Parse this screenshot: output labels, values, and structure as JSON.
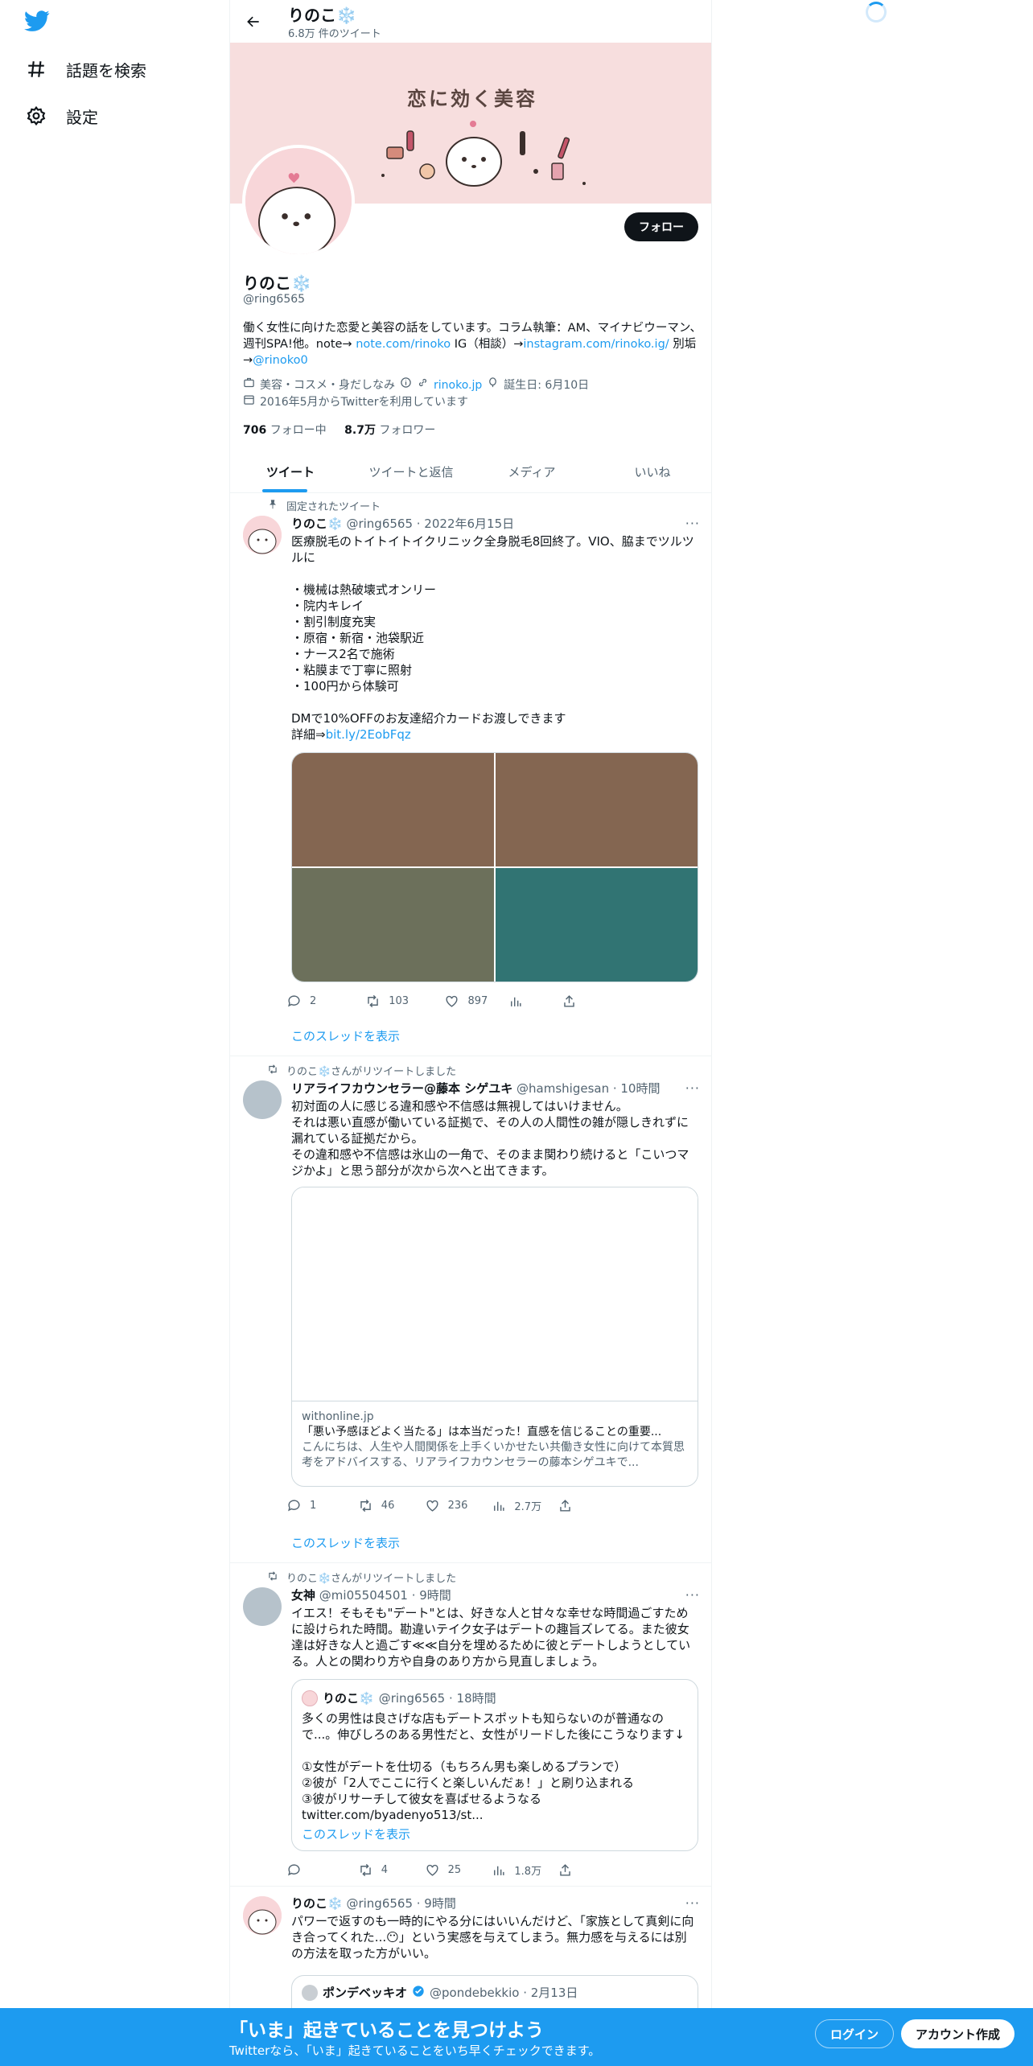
{
  "nav": {
    "logo": "twitter-bird",
    "items": [
      {
        "label": "話題を検索",
        "icon": "hashtag-icon"
      },
      {
        "label": "設定",
        "icon": "gear-icon"
      }
    ]
  },
  "header": {
    "title": "りのこ❄️",
    "subtitle": "6.8万 件のツイート"
  },
  "banner": {
    "text": "恋に効く美容"
  },
  "profile": {
    "follow_label": "フォロー",
    "name": "りのこ❄️",
    "handle": "@ring6565",
    "bio_pre": "働く女性に向けた恋愛と美容の話をしています。コラム執筆：AM、マイナビウーマン、週刊SPA!他。note→ ",
    "bio_link1": "note.com/rinoko",
    "bio_mid": " IG（相談）→",
    "bio_link2": "instagram.com/rinoko.ig/",
    "bio_mid2": " 別垢→",
    "bio_link3": "@rinoko0",
    "category": "美容・コスメ・身だしなみ",
    "website": "rinoko.jp",
    "birthday": "誕生日: 6月10日",
    "joined": "2016年5月からTwitterを利用しています",
    "following_count": "706",
    "following_label": "フォロー中",
    "followers_count": "8.7万",
    "followers_label": "フォロワー"
  },
  "tabs": [
    "ツイート",
    "ツイートと返信",
    "メディア",
    "いいね"
  ],
  "tweets": [
    {
      "context": "固定されたツイート",
      "name": "りのこ❄️",
      "meta": "@ring6565 · 2022年6月15日",
      "body": "医療脱毛のトイトイトイクリニック全身脱毛8回終了。VIO、脇までツルツルに\n\n・機械は熱破壊式オンリー\n・院内キレイ\n・割引制度充実\n・原宿・新宿・池袋駅近\n・ナース2名で施術\n・粘膜まで丁寧に照射\n・100円から体験可\n\nDMで10%OFFのお友達紹介カードお渡しできます\n詳細⇒",
      "link": "bit.ly/2EobFqz",
      "media_colors": [
        "#846651",
        "#846651",
        "#6c705b",
        "#317473"
      ],
      "replies": "2",
      "retweets": "103",
      "likes": "897",
      "views": "",
      "thread": "このスレッドを表示"
    },
    {
      "context": "りのこ❄️さんがリツイートしました",
      "name": "リアライフカウンセラー@藤本 シゲユキ",
      "meta": "@hamshigesan · 10時間",
      "body": "初対面の人に感じる違和感や不信感は無視してはいけません。\nそれは悪い直感が働いている証拠で、その人の人間性の雑が隠しきれずに漏れている証拠だから。\nその違和感や不信感は氷山の一角で、そのまま関わり続けると「こいつマジかよ」と思う部分が次から次へと出てきます。",
      "card_domain": "withonline.jp",
      "card_title": "「悪い予感ほどよく当たる」は本当だった！直感を信じることの重要...",
      "card_desc": "こんにちは、人生や人間関係を上手くいかせたい共働き女性に向けて本質思考をアドバイスする、リアライフカウンセラーの藤本シゲユキで...",
      "replies": "1",
      "retweets": "46",
      "likes": "236",
      "views": "2.7万",
      "thread": "このスレッドを表示"
    },
    {
      "context": "りのこ❄️さんがリツイートしました",
      "name": "女神",
      "meta": "@mi05504501 · 9時間",
      "body": "イエス！そもそも\"デート\"とは、好きな人と甘々な幸せな時間過ごすために設けられた時間。勘違いテイク女子はデートの趣旨ズレてる。また彼女達は好きな人と過ごす≪≪自分を埋めるために彼とデートしようとしている。人との関わり方や自身のあり方から見直しましょう。",
      "quote_name": "りのこ❄️",
      "quote_meta": "@ring6565 · 18時間",
      "quote_body": "多くの男性は良さげな店もデートスポットも知らないのが普通なので...。伸びしろのある男性だと、女性がリードした後にこうなります↓\n\n①女性がデートを仕切る（もちろん男も楽しめるプランで）\n②彼が「2人でここに行くと楽しいんだぁ！」と刷り込まれる\n③彼がリサーチして彼女を喜ばせるようなる\ntwitter.com/byadenyo513/st...",
      "quote_thread": "このスレッドを表示",
      "replies": "",
      "retweets": "4",
      "likes": "25",
      "views": "1.8万"
    },
    {
      "name": "りのこ❄️",
      "meta": "@ring6565 · 9時間",
      "body": "パワーで返すのも一時的にやる分にはいいんだけど、「家族として真剣に向き合ってくれた...😶」という実感を与えてしまう。無力感を与えるには別の方法を取った方がいい。",
      "quote_name": "ポンデベッキオ",
      "quote_meta": "@pondebekkio · 2月13日"
    }
  ],
  "bottom": {
    "title": "「いま」起きていることを見つけよう",
    "subtitle": "Twitterなら、「いま」起きていることをいち早くチェックできます。",
    "login": "ログイン",
    "signup": "アカウント作成"
  },
  "colors": {
    "accent": "#1d9bf0",
    "text": "#0f1419",
    "muted": "#536471"
  }
}
